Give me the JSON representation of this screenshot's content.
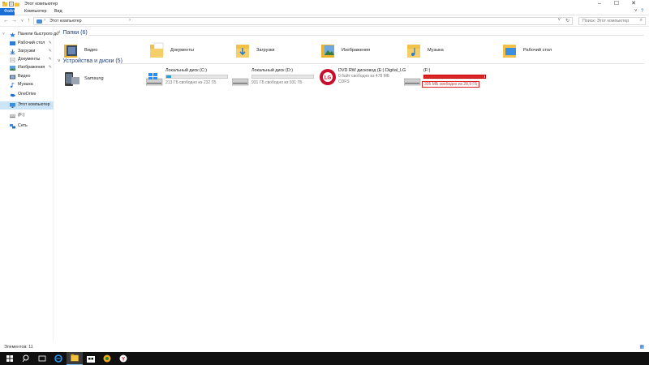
{
  "window": {
    "title": "Этот компьютер"
  },
  "ribbon": {
    "tabs": [
      "Файл",
      "Компьютер",
      "Вид"
    ]
  },
  "address": {
    "path": "Этот компьютер",
    "search_placeholder": "Поиск: Этот компьютер"
  },
  "nav": {
    "items": [
      {
        "label": "Панели быстрого до",
        "icon": "star-icon"
      },
      {
        "label": "Рабочий стол",
        "icon": "desktop-icon"
      },
      {
        "label": "Загрузки",
        "icon": "downloads-icon"
      },
      {
        "label": "Документы",
        "icon": "documents-icon"
      },
      {
        "label": "Изображения",
        "icon": "pictures-icon"
      },
      {
        "label": "Видео",
        "icon": "video-icon"
      },
      {
        "label": "Музыка",
        "icon": "music-icon"
      },
      {
        "label": "OneDrive",
        "icon": "onedrive-icon"
      },
      {
        "label": "Этот компьютер",
        "icon": "computer-icon"
      },
      {
        "label": "(F:)",
        "icon": "usb-drive-icon"
      },
      {
        "label": "Сеть",
        "icon": "network-icon"
      }
    ]
  },
  "folders": {
    "header": "Папки (6)",
    "items": [
      {
        "label": "Видео",
        "icon": "video-folder-icon"
      },
      {
        "label": "Документы",
        "icon": "documents-folder-icon"
      },
      {
        "label": "Загрузки",
        "icon": "downloads-folder-icon"
      },
      {
        "label": "Изображения",
        "icon": "pictures-folder-icon"
      },
      {
        "label": "Музыка",
        "icon": "music-folder-icon"
      },
      {
        "label": "Рабочий стол",
        "icon": "desktop-folder-icon"
      }
    ]
  },
  "devices": {
    "header": "Устройства и диски (5)",
    "phone": {
      "label": "Samsung",
      "icon": "phone-icon"
    },
    "drives": [
      {
        "name": "Локальный диск (C:)",
        "free": "213 ГБ свободно из 232 ГБ",
        "used_fraction": 0.08,
        "icon": "windows-drive-icon"
      },
      {
        "name": "Локальный диск (D:)",
        "free": "931 ГБ свободно из 931 ГБ",
        "used_fraction": 0.0,
        "icon": "hard-drive-icon"
      },
      {
        "name": "DVD RW дисковод (E:) Digital_LG",
        "free": "0 байт свободно из 478 МБ",
        "free2": "CDFS",
        "icon": "dvd-lg-icon"
      },
      {
        "name": "(F:)",
        "free": "305 МБ свободно из 28,9 ГБ",
        "used_fraction": 0.99,
        "icon": "usb-drive-icon"
      }
    ]
  },
  "status": {
    "count": "Элементов: 11"
  },
  "colors": {
    "accent": "#1a6ed8",
    "bar_normal": "#26a0da",
    "bar_full": "#da2626",
    "highlight_box": "#e02020"
  }
}
